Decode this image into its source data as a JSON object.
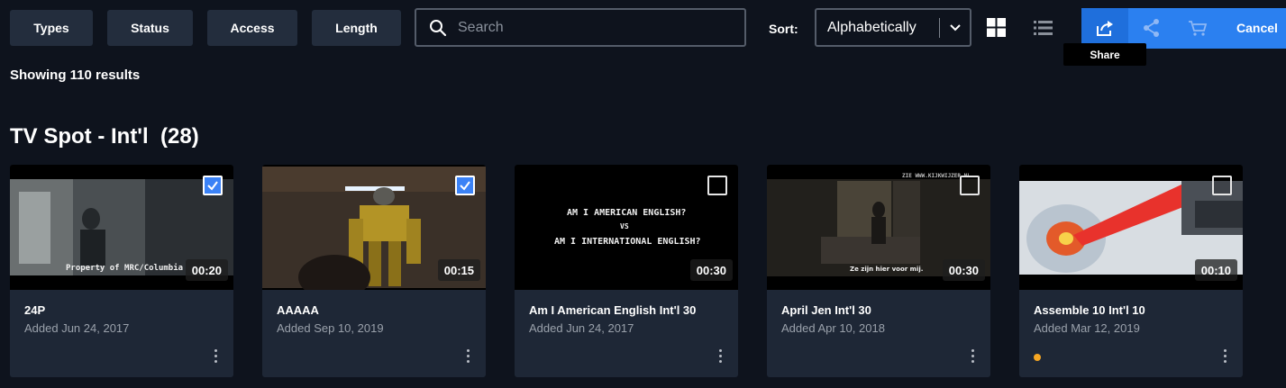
{
  "filters": [
    {
      "label": "Types"
    },
    {
      "label": "Status"
    },
    {
      "label": "Access"
    },
    {
      "label": "Length"
    }
  ],
  "search": {
    "placeholder": "Search",
    "value": ""
  },
  "sort": {
    "label": "Sort:",
    "selected": "Alphabetically"
  },
  "view_icons": [
    "grid-view-icon",
    "list-view-icon"
  ],
  "action_bar": {
    "icons": [
      "share-icon",
      "share-nodes-icon",
      "cart-icon"
    ],
    "cancel_label": "Cancel",
    "tooltip": "Share",
    "color": "#2b80f0"
  },
  "results_text": "Showing 110 results",
  "section": {
    "title": "TV Spot - Int'l",
    "count": "(28)"
  },
  "cards": [
    {
      "title": "24P",
      "date": "Added Jun 24, 2017",
      "duration": "00:20",
      "checked": true,
      "overlay": "Property of MRC/Columbia"
    },
    {
      "title": "AAAAA",
      "date": "Added Sep 10, 2019",
      "duration": "00:15",
      "checked": true
    },
    {
      "title": "Am I American English Int'l 30",
      "date": "Added Jun 24, 2017",
      "duration": "00:30",
      "checked": false,
      "overlay_lines": [
        "AM I AMERICAN ENGLISH?",
        "VS",
        "AM I INTERNATIONAL ENGLISH?"
      ]
    },
    {
      "title": "April Jen Int'l 30",
      "date": "Added Apr 10, 2018",
      "duration": "00:30",
      "checked": false,
      "overlay": "Ze zijn hier voor mij.",
      "overlay_top": "ZIE WWW.KIJKWIJZER.NL"
    },
    {
      "title": "Assemble 10 Int'l 10",
      "date": "Added Mar 12, 2019",
      "duration": "00:10",
      "checked": false,
      "status_color": "#f5a623"
    }
  ]
}
